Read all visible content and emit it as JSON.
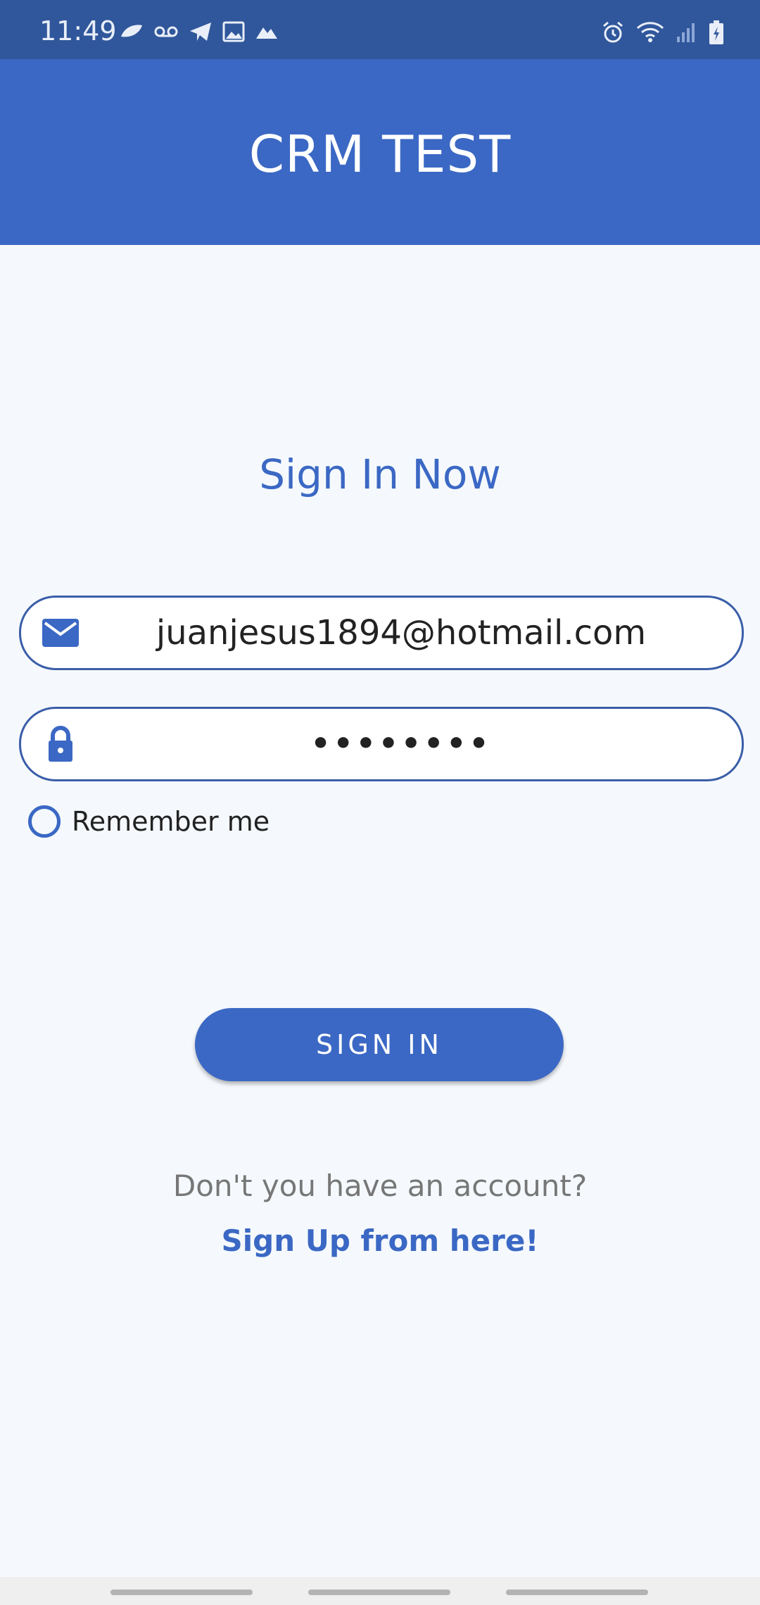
{
  "status_bar": {
    "time": "11:49",
    "left_icons": [
      "leaf-icon",
      "voicemail-icon",
      "telegram-icon",
      "image-icon",
      "mountain-icon"
    ],
    "right_icons": [
      "alarm-icon",
      "wifi-icon",
      "signal-icon",
      "battery-icon"
    ]
  },
  "app_bar": {
    "title": "CRM TEST"
  },
  "login": {
    "heading": "Sign In Now",
    "email": {
      "value": "juanjesus1894@hotmail.com",
      "icon": "mail-icon"
    },
    "password": {
      "value": "••••••••",
      "icon": "lock-icon"
    },
    "remember_label": "Remember me",
    "remember_checked": false,
    "signin_label": "SIGN IN",
    "account_prompt": "Don't you have an account?",
    "signup_link": "Sign Up from here!"
  },
  "colors": {
    "primary": "#3b68c4",
    "status_bar": "#30579b",
    "background": "#f5f9fd"
  }
}
